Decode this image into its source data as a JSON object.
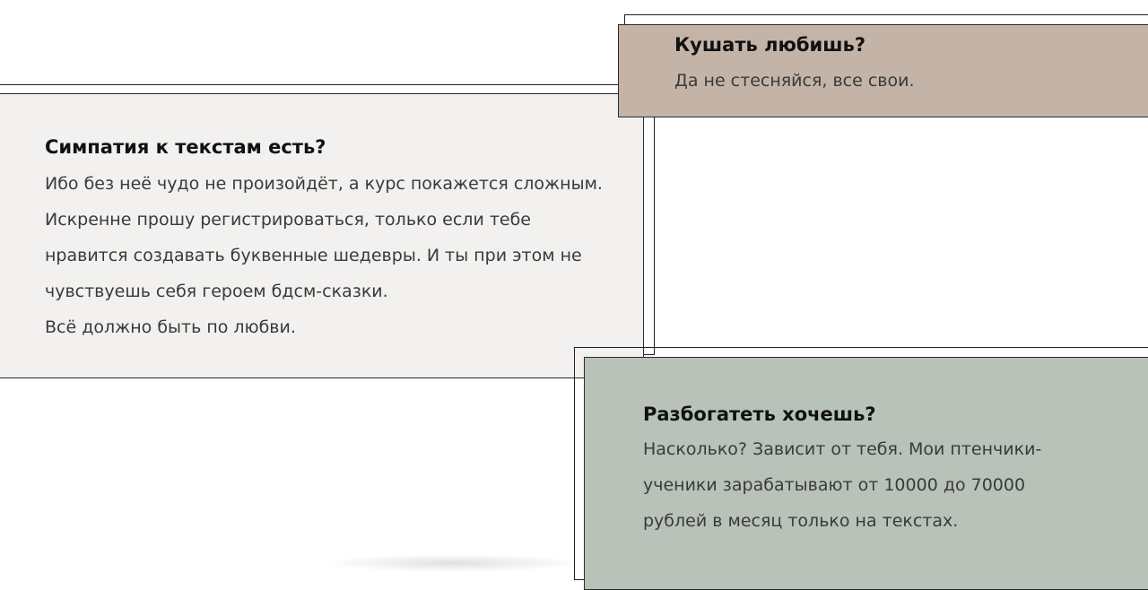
{
  "cards": {
    "eat": {
      "title": "Кушать любишь?",
      "lines": [
        "Да не стесняйся, все свои."
      ],
      "background": "#c4b4a7"
    },
    "sympathy": {
      "title": "Симпатия к текстам есть?",
      "lines": [
        "Ибо без неё чудо не произойдёт, а курс покажется сложным.",
        "Искренне прошу регистрироваться, только если тебе",
        "нравится создавать буквенные шедевры. И ты при этом не",
        "чувствуешь себя героем бдсм-сказки.",
        "Всё должно быть по любви."
      ],
      "background": "#f3f1ef"
    },
    "rich": {
      "title": "Разбогатеть хочешь?",
      "lines": [
        "Насколько? Зависит от тебя. Мои птенчики-",
        "ученики зарабатывают от 10000 до 70000",
        "рублей в месяц только на текстах."
      ],
      "background": "#b9c2b9"
    }
  },
  "colors": {
    "border": "#1f1f1f",
    "title": "#111111",
    "text": "#3a3a3a"
  }
}
